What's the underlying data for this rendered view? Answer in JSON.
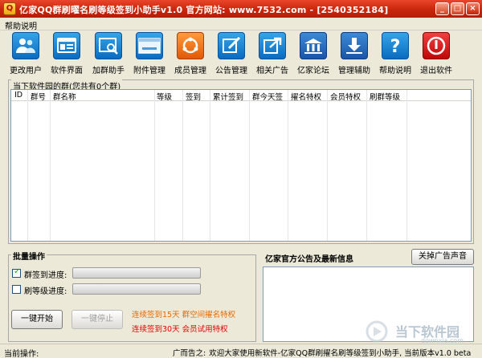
{
  "window": {
    "title": "亿家QQ群刷曜名刷等级签到小助手v1.0    官方网站: www.7532.com - [2540352184]",
    "minimize": "_",
    "maximize": "□",
    "close": "×"
  },
  "menu": {
    "help": "帮助说明"
  },
  "toolbar": {
    "items": [
      {
        "label": "更改用户",
        "icon": "users-icon"
      },
      {
        "label": "软件界面",
        "icon": "software-ui-icon"
      },
      {
        "label": "加群助手",
        "icon": "search-window-icon"
      },
      {
        "label": "附件管理",
        "icon": "download-window-icon"
      },
      {
        "label": "成员管理",
        "icon": "members-icon"
      },
      {
        "label": "公告管理",
        "icon": "announcement-edit-icon"
      },
      {
        "label": "相关广告",
        "icon": "ad-link-icon"
      },
      {
        "label": "亿家论坛",
        "icon": "forum-icon"
      },
      {
        "label": "管理辅助",
        "icon": "download-arrow-icon"
      },
      {
        "label": "帮助说明",
        "icon": "help-icon"
      },
      {
        "label": "退出软件",
        "icon": "exit-icon"
      }
    ]
  },
  "groups": {
    "title": "当下软件园的群(您共有0个群)",
    "columns": [
      "ID",
      "群号",
      "群名称",
      "等级",
      "签到",
      "累计签到",
      "群今天签",
      "擢名特权",
      "会员特权",
      "刷群等级"
    ]
  },
  "batch": {
    "title": "批量操作",
    "sign_label": "群签到",
    "sign_checked": true,
    "level_label": "刷等级",
    "level_checked": false,
    "progress_label": "进度:",
    "sign_progress": 0,
    "level_progress": 0,
    "start_button": "一键开始",
    "stop_button": "一键停止",
    "promo1": "连续签到15天  群空间擢名特权",
    "promo2": "连续签到30天  会员试用特权"
  },
  "announce": {
    "title": "亿家官方公告及最新信息",
    "close_ad_button": "关掉广告声音"
  },
  "status": {
    "current_op_label": "当前操作:",
    "ad_label": "广而告之:",
    "ad_text": "欢迎大家使用新软件-亿家QQ群刷擢名刷等级签到小助手, 当前版本v1.0 beta"
  },
  "watermark": {
    "text": "当下软件园",
    "url": "downxia.com"
  },
  "colors": {
    "titlebar": "#c8260c",
    "toolbar_blue": "#0a6cc0",
    "toolbar_orange": "#e25a05",
    "exit_red": "#c00808",
    "promo_orange": "#e56a00",
    "promo_red": "#e00000"
  }
}
